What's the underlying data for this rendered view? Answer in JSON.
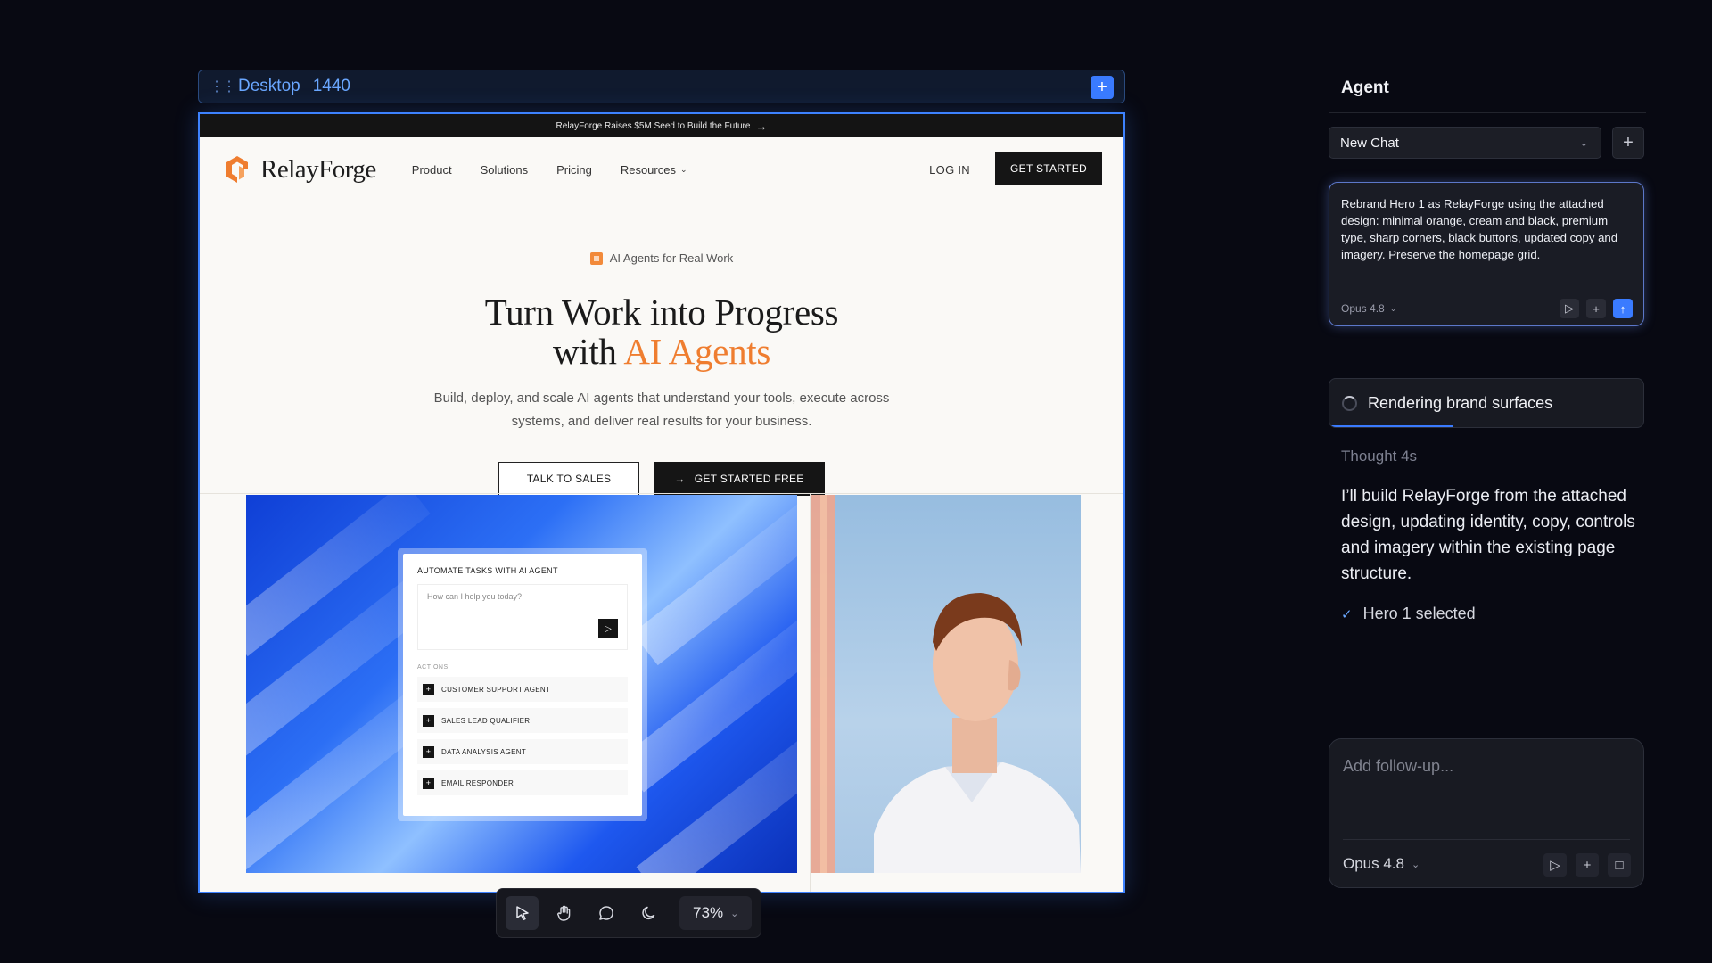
{
  "frame": {
    "name": "Desktop",
    "size": "1440"
  },
  "site": {
    "announcement": "RelayForge Raises $5M Seed to Build the Future",
    "brand": "RelayForge",
    "nav": {
      "links": [
        "Product",
        "Solutions",
        "Pricing",
        "Resources"
      ],
      "login": "LOG IN",
      "cta": "GET STARTED"
    },
    "hero": {
      "badge": "AI Agents for Real Work",
      "headline_line1": "Turn Work into Progress",
      "headline_prefix": "with ",
      "headline_accent": "AI Agents",
      "subtext": "Build, deploy, and scale AI agents that understand your tools, execute across systems, and deliver real results for your business.",
      "cta_secondary": "TALK TO SALES",
      "cta_primary": "GET STARTED FREE"
    },
    "agent_card": {
      "title": "AUTOMATE TASKS WITH AI AGENT",
      "input_placeholder": "How can I help you today?",
      "actions_label": "ACTIONS",
      "actions": [
        "CUSTOMER SUPPORT AGENT",
        "SALES LEAD QUALIFIER",
        "DATA ANALYSIS AGENT",
        "EMAIL RESPONDER"
      ]
    }
  },
  "toolbar": {
    "zoom": "73%"
  },
  "panel": {
    "title": "Agent",
    "chat_select": "New Chat",
    "prompt": "Rebrand Hero 1 as RelayForge using the attached design: minimal orange, cream and black, premium type, sharp corners, black buttons, updated copy and imagery. Preserve the homepage grid.",
    "prompt_model": "Opus 4.8",
    "status": "Rendering brand surfaces",
    "thought": "Thought 4s",
    "reply": "I’ll build RelayForge from the attached design, updating identity, copy, controls and imagery within the existing page structure.",
    "check": "Hero 1 selected",
    "followup_placeholder": "Add follow-up...",
    "followup_model": "Opus 4.8"
  },
  "colors": {
    "accent_blue": "#3a7bff",
    "brand_orange": "#ef7d2f",
    "site_cream": "#faf9f6",
    "dark_bg": "#080912"
  }
}
